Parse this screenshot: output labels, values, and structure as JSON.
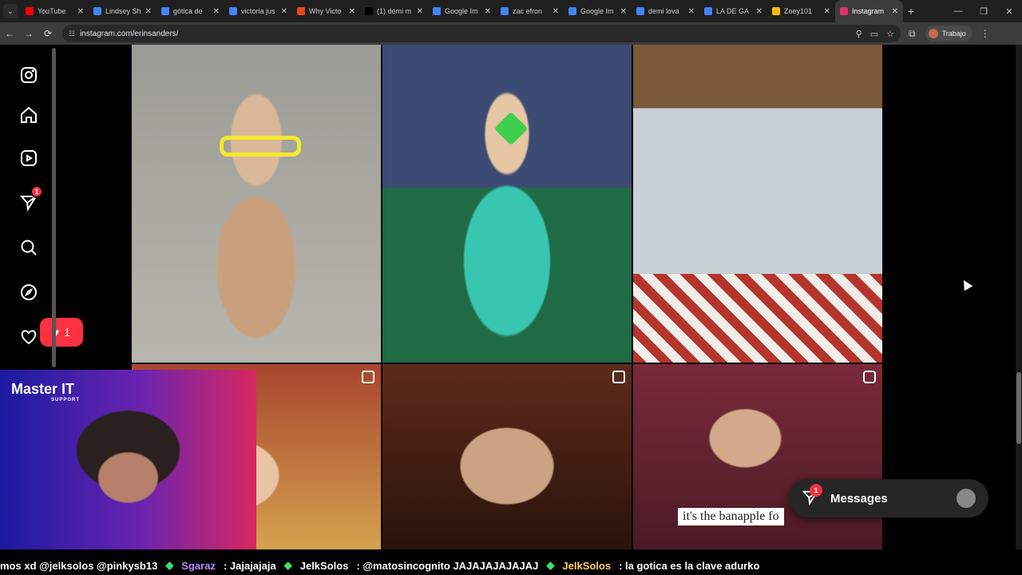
{
  "browser": {
    "tabs": [
      {
        "title": "YouTube",
        "color": "#ff0000"
      },
      {
        "title": "Lindsey Sh",
        "color": "#4285f4"
      },
      {
        "title": "gótica de",
        "color": "#4285f4"
      },
      {
        "title": "victoria jus",
        "color": "#4285f4"
      },
      {
        "title": "Why Victo",
        "color": "#e64a19"
      },
      {
        "title": "(1) demi m",
        "color": "#000000"
      },
      {
        "title": "Google Im",
        "color": "#4285f4"
      },
      {
        "title": "zac efron",
        "color": "#4285f4"
      },
      {
        "title": "Google Im",
        "color": "#4285f4"
      },
      {
        "title": "demi lova",
        "color": "#4285f4"
      },
      {
        "title": "LA DE GA",
        "color": "#4285f4"
      },
      {
        "title": "Zoey101",
        "color": "#fbbc04"
      },
      {
        "title": "Instagram",
        "color": "#e1306c",
        "active": true
      }
    ],
    "url": "instagram.com/erinsanders/",
    "profile_label": "Trabajo"
  },
  "sidebar": {
    "notification_count": "1",
    "like_count": "1"
  },
  "posts": [
    {
      "caption": ""
    },
    {
      "caption": ""
    },
    {
      "caption": ""
    },
    {
      "caption": ""
    },
    {
      "caption": ""
    },
    {
      "caption": "it's the banapple fo"
    }
  ],
  "stream_overlay": {
    "brand": "Master IT",
    "brand_sub": "SUPPORT"
  },
  "messages": {
    "label": "Messages",
    "count": "1"
  },
  "chat_ticker": [
    {
      "user": "",
      "text": "mos xd @jelksolos @pinkysb13"
    },
    {
      "user": "Sgaraz",
      "text": ": Jajajajaja"
    },
    {
      "user": "JelkSolos",
      "text": ": @matosincognito JAJAJAJAJAJAJ"
    },
    {
      "user": "JelkSolos",
      "text": ": la gotica es la clave adurko"
    }
  ]
}
